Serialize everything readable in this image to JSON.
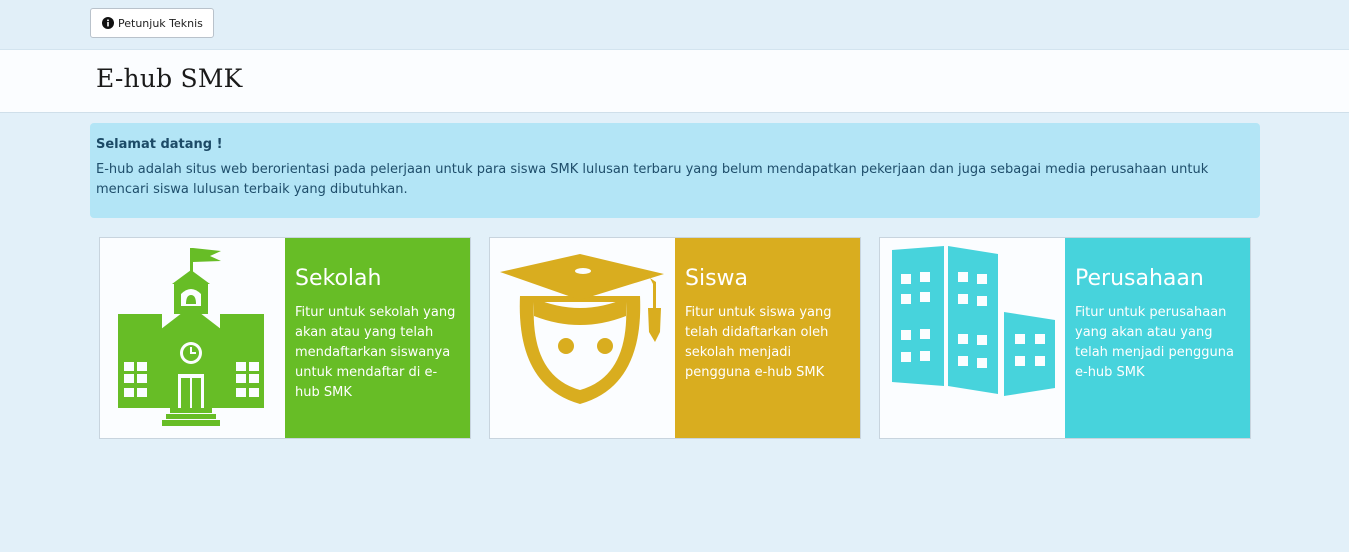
{
  "topbar": {
    "guide_button_label": "Petunjuk Teknis"
  },
  "header": {
    "title": "E-hub SMK"
  },
  "welcome": {
    "title": "Selamat datang !",
    "body": "E-hub adalah situs web berorientasi pada pelerjaan untuk para siswa SMK lulusan terbaru yang belum mendapatkan pekerjaan dan juga sebagai media perusahaan untuk mencari siswa lulusan terbaik yang dibutuhkan."
  },
  "cards": [
    {
      "title": "Sekolah",
      "description": "Fitur untuk sekolah yang akan atau yang telah mendaftarkan siswanya untuk mendaftar di e-hub SMK",
      "icon": "school-building-icon",
      "color": "#67bd26"
    },
    {
      "title": "Siswa",
      "description": "Fitur untuk siswa yang telah didaftarkan oleh sekolah menjadi pengguna e-hub SMK",
      "icon": "graduate-student-icon",
      "color": "#d9ad1f"
    },
    {
      "title": "Perusahaan",
      "description": "Fitur untuk perusahaan yang akan atau yang telah menjadi pengguna e-hub SMK",
      "icon": "office-buildings-icon",
      "color": "#47d3dc"
    }
  ]
}
